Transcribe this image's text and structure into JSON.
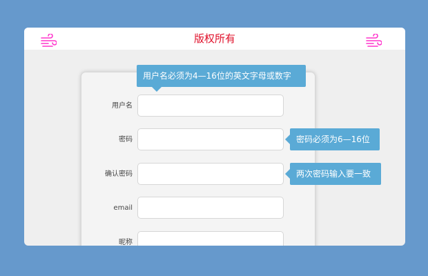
{
  "header": {
    "title": "版权所有",
    "icon_left": "wind-icon",
    "icon_right": "wind-icon",
    "title_color": "#e0102a",
    "icon_color": "#ff33cc"
  },
  "form": {
    "fields": [
      {
        "label": "用户名",
        "value": ""
      },
      {
        "label": "密码",
        "value": ""
      },
      {
        "label": "确认密码",
        "value": ""
      },
      {
        "label": "email",
        "value": ""
      },
      {
        "label": "昵称",
        "value": ""
      }
    ]
  },
  "tooltips": {
    "username": "用户名必须为4—16位的英文字母或数字",
    "password": "密码必须为6—16位",
    "confirm": "两次密码输入要一致",
    "color": "#5aaad6"
  },
  "page": {
    "background": "#6699cc"
  }
}
